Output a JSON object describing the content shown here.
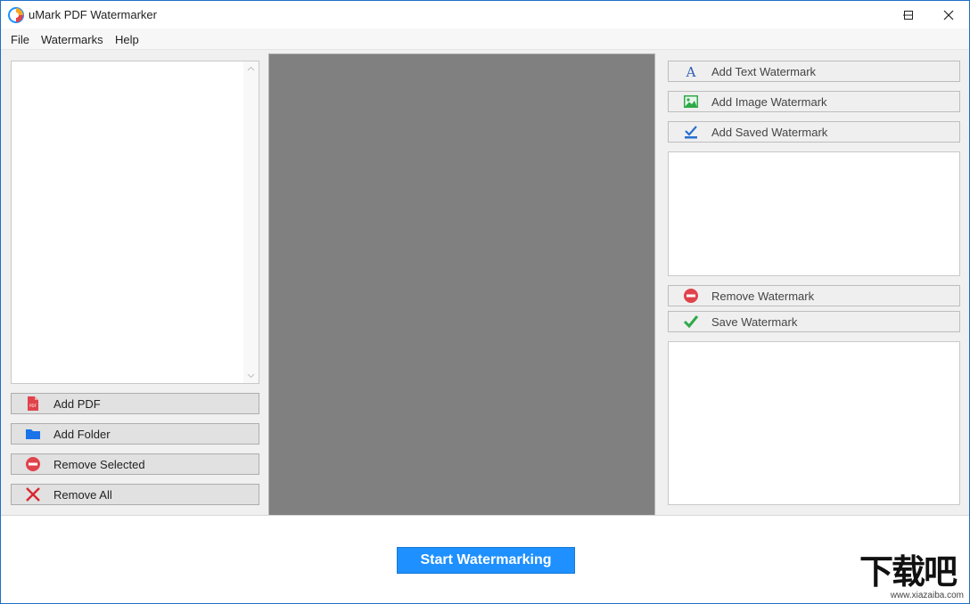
{
  "window": {
    "title": "uMark PDF Watermarker"
  },
  "menu": {
    "items": [
      "File",
      "Watermarks",
      "Help"
    ]
  },
  "left_panel": {
    "buttons": [
      {
        "label": "Add PDF",
        "icon": "pdf-file-icon"
      },
      {
        "label": "Add Folder",
        "icon": "folder-icon"
      },
      {
        "label": "Remove Selected",
        "icon": "minus-circle-icon"
      },
      {
        "label": "Remove All",
        "icon": "close-x-icon"
      }
    ]
  },
  "right_panel": {
    "add_buttons": [
      {
        "label": "Add Text Watermark",
        "icon": "text-a-icon"
      },
      {
        "label": "Add Image Watermark",
        "icon": "image-icon"
      },
      {
        "label": "Add Saved Watermark",
        "icon": "saved-check-icon"
      }
    ],
    "remove_label": "Remove Watermark",
    "save_label": "Save Watermark"
  },
  "footer": {
    "start_label": "Start Watermarking"
  },
  "logo": {
    "text": "下载吧",
    "sub": "www.xiazaiba.com"
  },
  "colors": {
    "accent": "#1e90ff",
    "preview_bg": "#808080",
    "remove_red": "#e0434b",
    "save_green": "#2eaa4a",
    "folder_blue": "#1a73e8"
  }
}
